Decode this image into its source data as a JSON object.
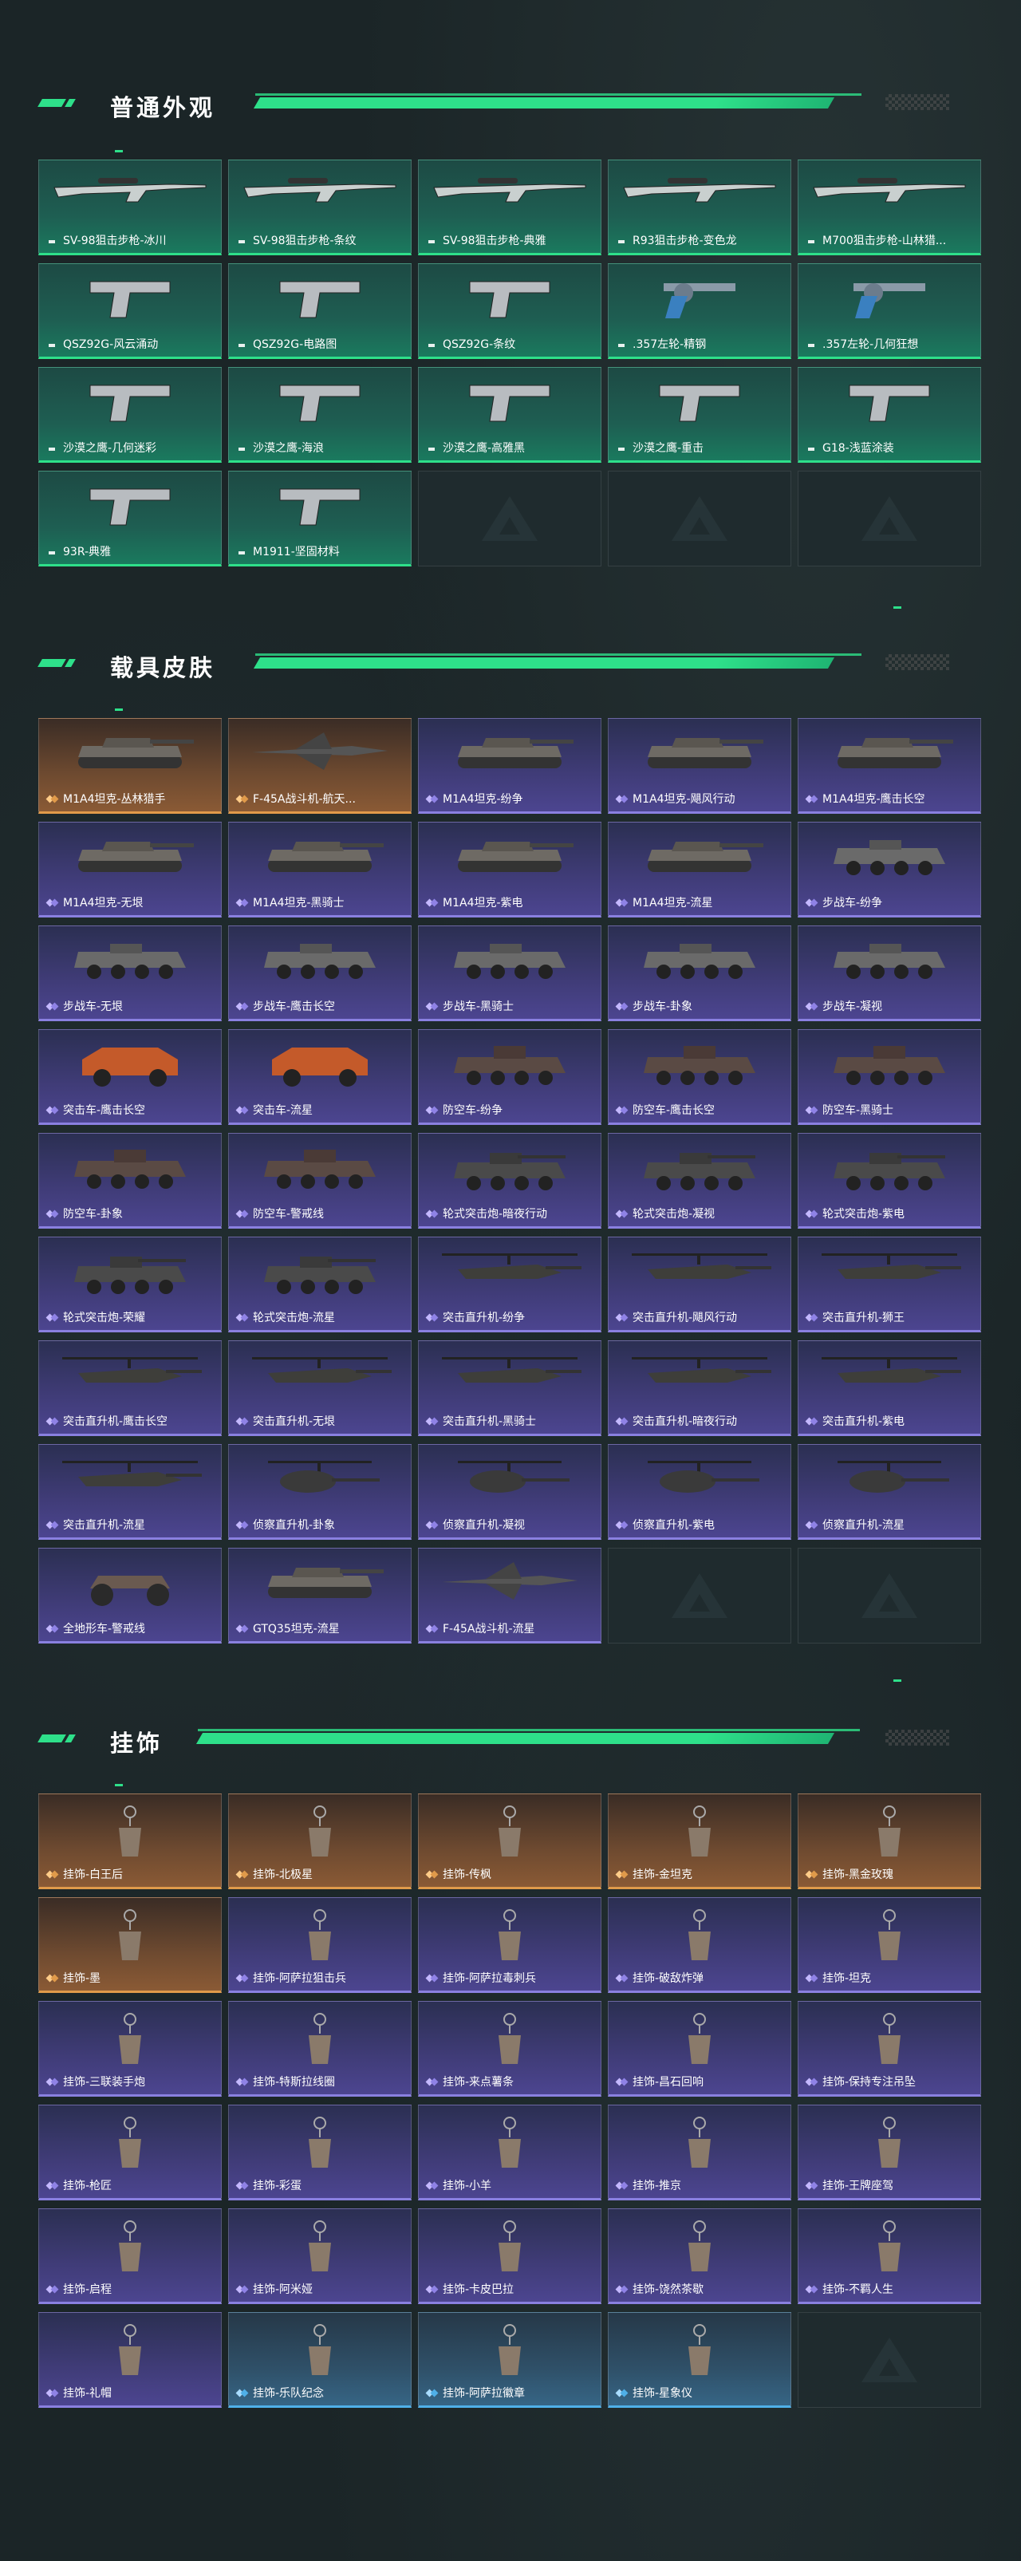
{
  "colors": {
    "background": "#1b2527",
    "accent": "#2ee08a",
    "normal_card": "#1e5e52",
    "rare_card": "#403c78",
    "legendary_card": "#6e4a30",
    "epic_card": "#2f5068"
  },
  "sections": {
    "weapons": {
      "title": "普通外观",
      "items": [
        {
          "label": "SV-98狙击步枪-冰川",
          "tier": "green",
          "icon": "sniper-rifle-icon"
        },
        {
          "label": "SV-98狙击步枪-条纹",
          "tier": "green",
          "icon": "sniper-rifle-icon"
        },
        {
          "label": "SV-98狙击步枪-典雅",
          "tier": "green",
          "icon": "sniper-rifle-icon"
        },
        {
          "label": "R93狙击步枪-变色龙",
          "tier": "green",
          "icon": "sniper-rifle-icon"
        },
        {
          "label": "M700狙击步枪-山林猎...",
          "tier": "green",
          "icon": "sniper-rifle-icon"
        },
        {
          "label": "QSZ92G-风云涌动",
          "tier": "green",
          "icon": "pistol-icon"
        },
        {
          "label": "QSZ92G-电路图",
          "tier": "green",
          "icon": "pistol-icon"
        },
        {
          "label": "QSZ92G-条纹",
          "tier": "green",
          "icon": "pistol-icon"
        },
        {
          "label": ".357左轮-精钢",
          "tier": "green",
          "icon": "revolver-icon"
        },
        {
          "label": ".357左轮-几何狂想",
          "tier": "green",
          "icon": "revolver-icon"
        },
        {
          "label": "沙漠之鹰-几何迷彩",
          "tier": "green",
          "icon": "pistol-icon"
        },
        {
          "label": "沙漠之鹰-海浪",
          "tier": "green",
          "icon": "pistol-icon"
        },
        {
          "label": "沙漠之鹰-高雅黑",
          "tier": "green",
          "icon": "pistol-icon"
        },
        {
          "label": "沙漠之鹰-重击",
          "tier": "green",
          "icon": "pistol-icon"
        },
        {
          "label": "G18-浅蓝涂装",
          "tier": "green",
          "icon": "pistol-icon"
        },
        {
          "label": "93R-典雅",
          "tier": "green",
          "icon": "pistol-icon"
        },
        {
          "label": "M1911-坚固材料",
          "tier": "green",
          "icon": "pistol-icon"
        },
        {
          "label": "",
          "tier": "empty",
          "icon": "placeholder-logo-icon"
        },
        {
          "label": "",
          "tier": "empty",
          "icon": "placeholder-logo-icon"
        },
        {
          "label": "",
          "tier": "empty",
          "icon": "placeholder-logo-icon"
        }
      ]
    },
    "vehicles": {
      "title": "载具皮肤",
      "items": [
        {
          "label": "M1A4坦克-丛林猎手",
          "tier": "orange",
          "icon": "tank-icon"
        },
        {
          "label": "F-45A战斗机-航天...",
          "tier": "orange",
          "icon": "jet-icon"
        },
        {
          "label": "M1A4坦克-纷争",
          "tier": "purple",
          "icon": "tank-icon"
        },
        {
          "label": "M1A4坦克-飓风行动",
          "tier": "purple",
          "icon": "tank-icon"
        },
        {
          "label": "M1A4坦克-鹰击长空",
          "tier": "purple",
          "icon": "tank-icon"
        },
        {
          "label": "M1A4坦克-无垠",
          "tier": "purple",
          "icon": "tank-icon"
        },
        {
          "label": "M1A4坦克-黑骑士",
          "tier": "purple",
          "icon": "tank-icon"
        },
        {
          "label": "M1A4坦克-紫电",
          "tier": "purple",
          "icon": "tank-icon"
        },
        {
          "label": "M1A4坦克-流星",
          "tier": "purple",
          "icon": "tank-icon"
        },
        {
          "label": "步战车-纷争",
          "tier": "purple",
          "icon": "ifv-icon"
        },
        {
          "label": "步战车-无垠",
          "tier": "purple",
          "icon": "ifv-icon"
        },
        {
          "label": "步战车-鹰击长空",
          "tier": "purple",
          "icon": "ifv-icon"
        },
        {
          "label": "步战车-黑骑士",
          "tier": "purple",
          "icon": "ifv-icon"
        },
        {
          "label": "步战车-卦象",
          "tier": "purple",
          "icon": "ifv-icon"
        },
        {
          "label": "步战车-凝视",
          "tier": "purple",
          "icon": "ifv-icon"
        },
        {
          "label": "突击车-鹰击长空",
          "tier": "purple",
          "icon": "assault-vehicle-icon"
        },
        {
          "label": "突击车-流星",
          "tier": "purple",
          "icon": "assault-vehicle-icon"
        },
        {
          "label": "防空车-纷争",
          "tier": "purple",
          "icon": "aa-vehicle-icon"
        },
        {
          "label": "防空车-鹰击长空",
          "tier": "purple",
          "icon": "aa-vehicle-icon"
        },
        {
          "label": "防空车-黑骑士",
          "tier": "purple",
          "icon": "aa-vehicle-icon"
        },
        {
          "label": "防空车-卦象",
          "tier": "purple",
          "icon": "aa-vehicle-icon"
        },
        {
          "label": "防空车-警戒线",
          "tier": "purple",
          "icon": "aa-vehicle-icon"
        },
        {
          "label": "轮式突击炮-暗夜行动",
          "tier": "purple",
          "icon": "wheeled-gun-icon"
        },
        {
          "label": "轮式突击炮-凝视",
          "tier": "purple",
          "icon": "wheeled-gun-icon"
        },
        {
          "label": "轮式突击炮-紫电",
          "tier": "purple",
          "icon": "wheeled-gun-icon"
        },
        {
          "label": "轮式突击炮-荣耀",
          "tier": "purple",
          "icon": "wheeled-gun-icon"
        },
        {
          "label": "轮式突击炮-流星",
          "tier": "purple",
          "icon": "wheeled-gun-icon"
        },
        {
          "label": "突击直升机-纷争",
          "tier": "purple",
          "icon": "attack-helicopter-icon"
        },
        {
          "label": "突击直升机-飓风行动",
          "tier": "purple",
          "icon": "attack-helicopter-icon"
        },
        {
          "label": "突击直升机-狮王",
          "tier": "purple",
          "icon": "attack-helicopter-icon"
        },
        {
          "label": "突击直升机-鹰击长空",
          "tier": "purple",
          "icon": "attack-helicopter-icon"
        },
        {
          "label": "突击直升机-无垠",
          "tier": "purple",
          "icon": "attack-helicopter-icon"
        },
        {
          "label": "突击直升机-黑骑士",
          "tier": "purple",
          "icon": "attack-helicopter-icon"
        },
        {
          "label": "突击直升机-暗夜行动",
          "tier": "purple",
          "icon": "attack-helicopter-icon"
        },
        {
          "label": "突击直升机-紫电",
          "tier": "purple",
          "icon": "attack-helicopter-icon"
        },
        {
          "label": "突击直升机-流星",
          "tier": "purple",
          "icon": "attack-helicopter-icon"
        },
        {
          "label": "侦察直升机-卦象",
          "tier": "purple",
          "icon": "scout-helicopter-icon"
        },
        {
          "label": "侦察直升机-凝视",
          "tier": "purple",
          "icon": "scout-helicopter-icon"
        },
        {
          "label": "侦察直升机-紫电",
          "tier": "purple",
          "icon": "scout-helicopter-icon"
        },
        {
          "label": "侦察直升机-流星",
          "tier": "purple",
          "icon": "scout-helicopter-icon"
        },
        {
          "label": "全地形车-警戒线",
          "tier": "purple",
          "icon": "atv-icon"
        },
        {
          "label": "GTQ35坦克-流星",
          "tier": "purple",
          "icon": "tank-icon"
        },
        {
          "label": "F-45A战斗机-流星",
          "tier": "purple",
          "icon": "jet-icon"
        },
        {
          "label": "",
          "tier": "empty",
          "icon": "placeholder-logo-icon"
        },
        {
          "label": "",
          "tier": "empty",
          "icon": "placeholder-logo-icon"
        }
      ]
    },
    "charms": {
      "title": "挂饰",
      "items": [
        {
          "label": "挂饰-白王后",
          "tier": "orange",
          "icon": "charm-icon"
        },
        {
          "label": "挂饰-北极星",
          "tier": "orange",
          "icon": "charm-icon"
        },
        {
          "label": "挂饰-传枫",
          "tier": "orange",
          "icon": "charm-icon"
        },
        {
          "label": "挂饰-金坦克",
          "tier": "orange",
          "icon": "charm-icon"
        },
        {
          "label": "挂饰-黑金玫瑰",
          "tier": "orange",
          "icon": "charm-icon"
        },
        {
          "label": "挂饰-墨",
          "tier": "orange",
          "icon": "charm-icon"
        },
        {
          "label": "挂饰-阿萨拉狙击兵",
          "tier": "purple",
          "icon": "charm-icon"
        },
        {
          "label": "挂饰-阿萨拉毒刺兵",
          "tier": "purple",
          "icon": "charm-icon"
        },
        {
          "label": "挂饰-破敌炸弹",
          "tier": "purple",
          "icon": "charm-icon"
        },
        {
          "label": "挂饰-坦克",
          "tier": "purple",
          "icon": "charm-icon"
        },
        {
          "label": "挂饰-三联装手炮",
          "tier": "purple",
          "icon": "charm-icon"
        },
        {
          "label": "挂饰-特斯拉线圈",
          "tier": "purple",
          "icon": "charm-icon"
        },
        {
          "label": "挂饰-来点薯条",
          "tier": "purple",
          "icon": "charm-icon"
        },
        {
          "label": "挂饰-昌石回响",
          "tier": "purple",
          "icon": "charm-icon"
        },
        {
          "label": "挂饰-保持专注吊坠",
          "tier": "purple",
          "icon": "charm-icon"
        },
        {
          "label": "挂饰-枪匠",
          "tier": "purple",
          "icon": "charm-icon"
        },
        {
          "label": "挂饰-彩蛋",
          "tier": "purple",
          "icon": "charm-icon"
        },
        {
          "label": "挂饰-小羊",
          "tier": "purple",
          "icon": "charm-icon"
        },
        {
          "label": "挂饰-推京",
          "tier": "purple",
          "icon": "charm-icon"
        },
        {
          "label": "挂饰-王牌座驾",
          "tier": "purple",
          "icon": "charm-icon"
        },
        {
          "label": "挂饰-启程",
          "tier": "purple",
          "icon": "charm-icon"
        },
        {
          "label": "挂饰-阿米娅",
          "tier": "purple",
          "icon": "charm-icon"
        },
        {
          "label": "挂饰-卡皮巴拉",
          "tier": "purple",
          "icon": "charm-icon"
        },
        {
          "label": "挂饰-饶然茶歇",
          "tier": "purple",
          "icon": "charm-icon"
        },
        {
          "label": "挂饰-不羁人生",
          "tier": "purple",
          "icon": "charm-icon"
        },
        {
          "label": "挂饰-礼帽",
          "tier": "purple",
          "icon": "charm-icon"
        },
        {
          "label": "挂饰-乐队纪念",
          "tier": "blue",
          "icon": "charm-icon"
        },
        {
          "label": "挂饰-阿萨拉徽章",
          "tier": "blue",
          "icon": "charm-icon"
        },
        {
          "label": "挂饰-星象仪",
          "tier": "blue",
          "icon": "charm-icon"
        },
        {
          "label": "",
          "tier": "empty",
          "icon": "placeholder-logo-icon"
        }
      ]
    }
  }
}
